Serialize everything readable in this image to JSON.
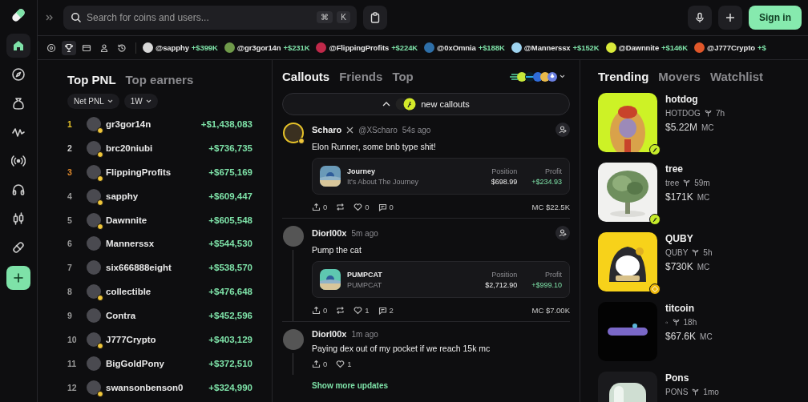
{
  "sidebar": {
    "items": [
      {
        "kind": "home",
        "selected": true
      },
      {
        "kind": "compass",
        "selected": false
      },
      {
        "kind": "bag",
        "selected": false
      },
      {
        "kind": "pulse",
        "selected": false
      },
      {
        "kind": "broadcast",
        "selected": false
      },
      {
        "kind": "headset",
        "selected": false
      },
      {
        "kind": "candles",
        "selected": false
      },
      {
        "kind": "pill",
        "selected": false
      },
      {
        "kind": "plus",
        "selected": false
      }
    ]
  },
  "search": {
    "placeholder": "Search for coins and users...",
    "keys": [
      "⌘",
      "K"
    ]
  },
  "header": {
    "sign_in": "Sign in"
  },
  "ticker": {
    "filters": [
      {
        "kind": "target",
        "selected": false
      },
      {
        "kind": "trophy",
        "selected": true
      },
      {
        "kind": "mail",
        "selected": false
      },
      {
        "kind": "person",
        "selected": false
      },
      {
        "kind": "history",
        "selected": false
      }
    ],
    "items": [
      {
        "handle": "@sapphy",
        "amount": "+$399K",
        "color": "#d8d8d8"
      },
      {
        "handle": "@gr3gor14n",
        "amount": "+$231K",
        "color": "#6f9a4a"
      },
      {
        "handle": "@FlippingProfits",
        "amount": "+$224K",
        "color": "#c0294a"
      },
      {
        "handle": "@0xOmnia",
        "amount": "+$188K",
        "color": "#2e6fa8"
      },
      {
        "handle": "@Mannerssx",
        "amount": "+$152K",
        "color": "#9fd4f0"
      },
      {
        "handle": "@Dawnnite",
        "amount": "+$146K",
        "color": "#d9ea3a"
      },
      {
        "handle": "@J777Crypto",
        "amount": "+$",
        "color": "#e0572a"
      }
    ]
  },
  "leaderboard": {
    "tabs": [
      {
        "label": "Top PNL",
        "selected": true
      },
      {
        "label": "Top earners",
        "selected": false
      }
    ],
    "filters": [
      "Net PNL",
      "1W"
    ],
    "rows": [
      {
        "rank": "1",
        "name": "gr3gor14n",
        "pnl": "+$1,438,083",
        "color": "#e6c229",
        "verified": true
      },
      {
        "rank": "2",
        "name": "brc20niubi",
        "pnl": "+$736,735",
        "color": "#cfcfcf",
        "verified": true
      },
      {
        "rank": "3",
        "name": "FlippingProfits",
        "pnl": "+$675,169",
        "color": "#e08a2c",
        "verified": true
      },
      {
        "rank": "4",
        "name": "sapphy",
        "pnl": "+$609,447",
        "color": "#9a9a9a",
        "verified": true
      },
      {
        "rank": "5",
        "name": "Dawnnite",
        "pnl": "+$605,548",
        "color": "#9a9a9a",
        "verified": true
      },
      {
        "rank": "6",
        "name": "Mannerssx",
        "pnl": "+$544,530",
        "color": "#9a9a9a",
        "verified": false
      },
      {
        "rank": "7",
        "name": "six666888eight",
        "pnl": "+$538,570",
        "color": "#9a9a9a",
        "verified": false
      },
      {
        "rank": "8",
        "name": "collectible",
        "pnl": "+$476,648",
        "color": "#9a9a9a",
        "verified": true
      },
      {
        "rank": "9",
        "name": "Contra",
        "pnl": "+$452,596",
        "color": "#9a9a9a",
        "verified": false
      },
      {
        "rank": "10",
        "name": "J777Crypto",
        "pnl": "+$403,129",
        "color": "#9a9a9a",
        "verified": true
      },
      {
        "rank": "11",
        "name": "BigGoldPony",
        "pnl": "+$372,510",
        "color": "#9a9a9a",
        "verified": false
      },
      {
        "rank": "12",
        "name": "swansonbenson0",
        "pnl": "+$324,990",
        "color": "#9a9a9a",
        "verified": true
      }
    ]
  },
  "feed": {
    "tabs": [
      {
        "label": "Callouts",
        "selected": true
      },
      {
        "label": "Friends",
        "selected": false
      },
      {
        "label": "Top",
        "selected": false
      }
    ],
    "new_callouts": "new callouts",
    "posts": [
      {
        "author": "Scharo",
        "handle": "@XScharo",
        "time": "54s ago",
        "verified": true,
        "text": "Elon Runner, some bnb type shit!",
        "token": {
          "name": "Journey",
          "subtitle": "It's About The Journey",
          "position_label": "Position",
          "position": "$698.99",
          "profit_label": "Profit",
          "profit": "+$234.93",
          "color": "#6a9ab8"
        },
        "actions": [
          {
            "kind": "share",
            "count": "0"
          },
          {
            "kind": "repost"
          },
          {
            "kind": "like",
            "count": "0"
          },
          {
            "kind": "comment",
            "count": "0"
          }
        ],
        "mc": "MC $22.5K"
      },
      {
        "author": "Diorl00x",
        "time": "5m ago",
        "verified": false,
        "text": "Pump the cat",
        "token": {
          "name": "PUMPCAT",
          "subtitle": "PUMPCAT",
          "position_label": "Position",
          "position": "$2,712.90",
          "profit_label": "Profit",
          "profit": "+$999.10",
          "color": "#5ec7b0"
        },
        "actions": [
          {
            "kind": "share",
            "count": "0"
          },
          {
            "kind": "repost"
          },
          {
            "kind": "like",
            "count": "1"
          },
          {
            "kind": "comment",
            "count": "2"
          }
        ],
        "mc": "MC $7.00K"
      },
      {
        "author": "Diorl00x",
        "time": "1m ago",
        "verified": false,
        "compact": true,
        "text": "Paying dex out of my pocket if we reach 15k mc",
        "actions": [
          {
            "kind": "share",
            "count": "0"
          },
          {
            "kind": "like",
            "count": "1"
          }
        ]
      }
    ],
    "show_more": "Show more updates"
  },
  "trending": {
    "tabs": [
      {
        "label": "Trending",
        "selected": true
      },
      {
        "label": "Movers",
        "selected": false
      },
      {
        "label": "Watchlist",
        "selected": false
      }
    ],
    "coins": [
      {
        "name": "hotdog",
        "ticker": "HOTDOG",
        "age": "7h",
        "mc": "$5.22M",
        "mc_unit": "MC",
        "kind": "feather"
      },
      {
        "name": "tree",
        "ticker": "tree",
        "age": "59m",
        "mc": "$171K",
        "mc_unit": "MC",
        "kind": "feather"
      },
      {
        "name": "QUBY",
        "ticker": "QUBY",
        "age": "5h",
        "mc": "$730K",
        "mc_unit": "MC",
        "kind": "diamond"
      },
      {
        "name": "titcoin",
        "ticker": "◦",
        "age": "18h",
        "mc": "$67.6K",
        "mc_unit": "MC",
        "kind": "plain"
      },
      {
        "name": "Pons",
        "ticker": "PONS",
        "age": "1mo",
        "kind": "plain"
      }
    ]
  }
}
